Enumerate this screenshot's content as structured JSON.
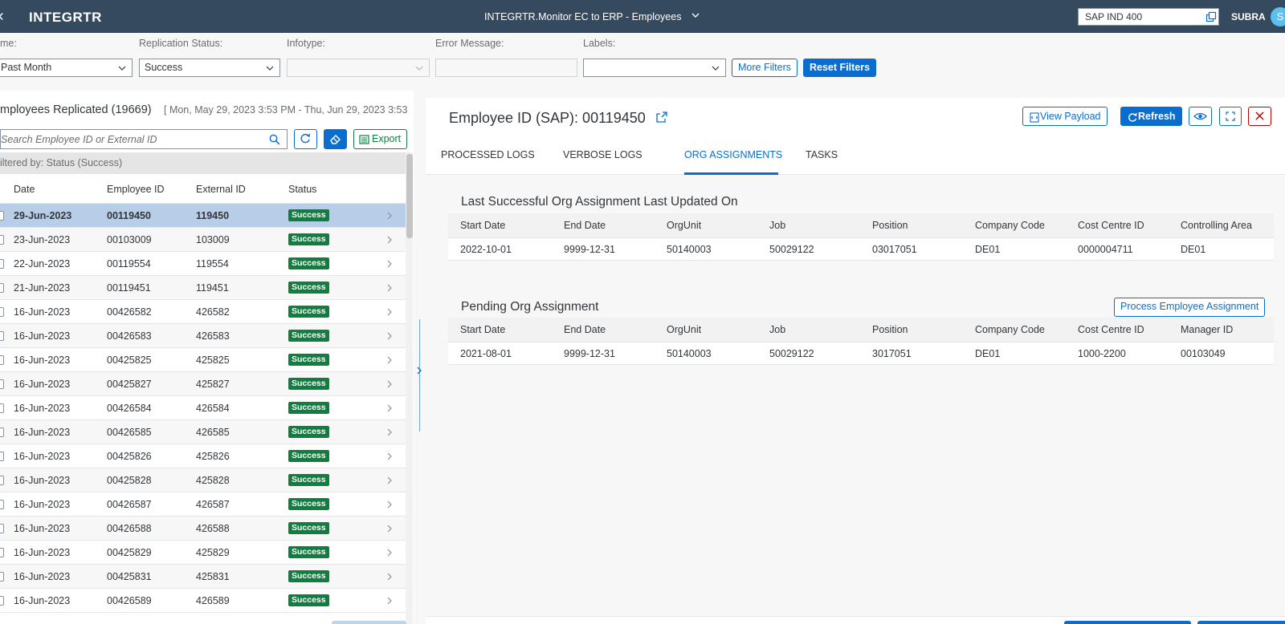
{
  "shell": {
    "back_glyph": "‹",
    "logo": "INTEGRTR",
    "title": "INTEGRTR.Monitor EC to ERP - Employees",
    "system": "SAP IND 400",
    "user": "SUBRA",
    "avatar_initial": "S"
  },
  "filters": {
    "time_label": "me:",
    "time_value": "Past Month",
    "status_label": "Replication Status:",
    "status_value": "Success",
    "infotype_label": "Infotype:",
    "error_label": "Error Message:",
    "labels_label": "Labels:",
    "more_filters": "More Filters",
    "reset_filters": "Reset Filters"
  },
  "list": {
    "title": "mployees Replicated (19669)",
    "range": "[ Mon, May 29, 2023 3:53 PM - Thu, Jun 29, 2023 3:53",
    "search_placeholder": "Search Employee ID or External ID",
    "export_label": "Export",
    "filtered_by": "iltered by: Status (Success)",
    "columns": [
      "Date",
      "Employee ID",
      "External ID",
      "Status"
    ],
    "rows": [
      {
        "date": "29-Jun-2023",
        "emp": "00119450",
        "ext": "119450",
        "status": "Success"
      },
      {
        "date": "23-Jun-2023",
        "emp": "00103009",
        "ext": "103009",
        "status": "Success"
      },
      {
        "date": "22-Jun-2023",
        "emp": "00119554",
        "ext": "119554",
        "status": "Success"
      },
      {
        "date": "21-Jun-2023",
        "emp": "00119451",
        "ext": "119451",
        "status": "Success"
      },
      {
        "date": "16-Jun-2023",
        "emp": "00426582",
        "ext": "426582",
        "status": "Success"
      },
      {
        "date": "16-Jun-2023",
        "emp": "00426583",
        "ext": "426583",
        "status": "Success"
      },
      {
        "date": "16-Jun-2023",
        "emp": "00425825",
        "ext": "425825",
        "status": "Success"
      },
      {
        "date": "16-Jun-2023",
        "emp": "00425827",
        "ext": "425827",
        "status": "Success"
      },
      {
        "date": "16-Jun-2023",
        "emp": "00426584",
        "ext": "426584",
        "status": "Success"
      },
      {
        "date": "16-Jun-2023",
        "emp": "00426585",
        "ext": "426585",
        "status": "Success"
      },
      {
        "date": "16-Jun-2023",
        "emp": "00425826",
        "ext": "425826",
        "status": "Success"
      },
      {
        "date": "16-Jun-2023",
        "emp": "00425828",
        "ext": "425828",
        "status": "Success"
      },
      {
        "date": "16-Jun-2023",
        "emp": "00426587",
        "ext": "426587",
        "status": "Success"
      },
      {
        "date": "16-Jun-2023",
        "emp": "00426588",
        "ext": "426588",
        "status": "Success"
      },
      {
        "date": "16-Jun-2023",
        "emp": "00425829",
        "ext": "425829",
        "status": "Success"
      },
      {
        "date": "16-Jun-2023",
        "emp": "00425831",
        "ext": "425831",
        "status": "Success"
      },
      {
        "date": "16-Jun-2023",
        "emp": "00426589",
        "ext": "426589",
        "status": "Success"
      }
    ]
  },
  "detail": {
    "title": "Employee ID (SAP): 00119450",
    "view_payload": "View Payload",
    "refresh": "Refresh",
    "tabs": [
      "PROCESSED LOGS",
      "VERBOSE LOGS",
      "ORG ASSIGNMENTS",
      "TASKS"
    ],
    "active_tab": "ORG ASSIGNMENTS",
    "last_section": {
      "title": "Last Successful Org Assignment  Last Updated On",
      "columns": [
        "Start Date",
        "End Date",
        "OrgUnit",
        "Job",
        "Position",
        "Company Code",
        "Cost Centre ID",
        "Controlling Area"
      ],
      "row": [
        "2022-10-01",
        "9999-12-31",
        "50140003",
        "50029122",
        "03017051",
        "DE01",
        "0000004711",
        "DE01"
      ]
    },
    "pending_section": {
      "title": "Pending Org Assignment",
      "process_button": "Process Employee Assignment",
      "columns": [
        "Start Date",
        "End Date",
        "OrgUnit",
        "Job",
        "Position",
        "Company Code",
        "Cost Centre ID",
        "Manager ID"
      ],
      "row": [
        "2021-08-01",
        "9999-12-31",
        "50140003",
        "50029122",
        "3017051",
        "DE01",
        "1000-2200",
        "00103049"
      ]
    }
  },
  "colors": {
    "shell": "#354a5f",
    "accent": "#0a6ed1",
    "success": "#107e3e",
    "selected_row": "#b7cde8",
    "negative": "#bb0000"
  }
}
